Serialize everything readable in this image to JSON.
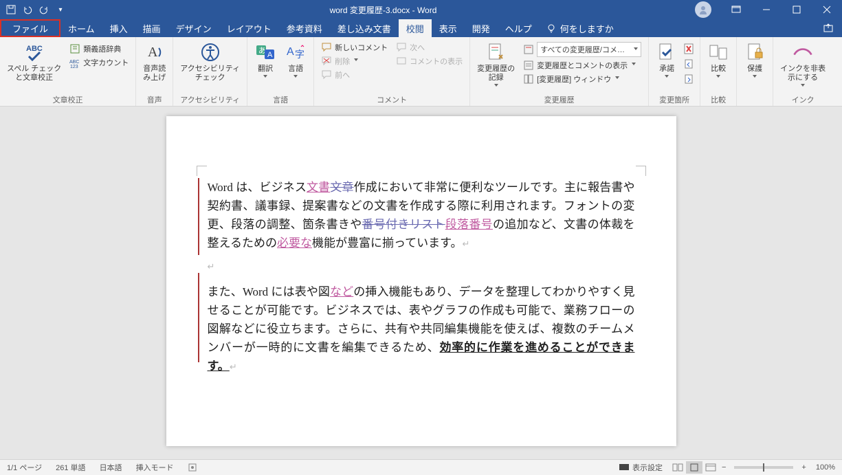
{
  "title": "word 変更履歴-3.docx  -  Word",
  "tabs": {
    "file": "ファイル",
    "home": "ホーム",
    "insert": "挿入",
    "draw": "描画",
    "design": "デザイン",
    "layout": "レイアウト",
    "references": "参考資料",
    "mailings": "差し込み文書",
    "review": "校閲",
    "view": "表示",
    "developer": "開発",
    "help": "ヘルプ",
    "search": "何をしますか"
  },
  "ribbon": {
    "proofing": {
      "spellcheck": "スペル チェック\nと文章校正",
      "thesaurus": "類義語辞典",
      "wordcount": "文字カウント",
      "group": "文章校正"
    },
    "speech": {
      "readaloud": "音声読\nみ上げ",
      "group": "音声"
    },
    "accessibility": {
      "check": "アクセシビリティ\nチェック",
      "group": "アクセシビリティ"
    },
    "language": {
      "translate": "翻訳",
      "language": "言語",
      "group": "言語"
    },
    "comments": {
      "new": "新しいコメント",
      "delete": "削除",
      "prev": "前へ",
      "next": "次へ",
      "show": "コメントの表示",
      "group": "コメント"
    },
    "tracking": {
      "track": "変更履歴の\n記録",
      "display_combo": "すべての変更履歴/コメ…",
      "showmarkup": "変更履歴とコメントの表示",
      "pane": "[変更履歴] ウィンドウ",
      "group": "変更履歴"
    },
    "changes": {
      "accept": "承諾",
      "group": "変更箇所"
    },
    "compare": {
      "compare": "比較",
      "group": "比較"
    },
    "protect": {
      "protect": "保護",
      "group": ""
    },
    "ink": {
      "hide": "インクを非表\n示にする",
      "group": "インク"
    }
  },
  "document": {
    "p1": {
      "t1": "Word は、ビジネス",
      "ins1": "文書",
      "del1": "文章",
      "t2": "作成において非常に便利なツールです。主に報告書や契約書、議事録、提案書などの文書を作成する際に利用されます。フォントの変更、段落の調整、箇条書きや",
      "del2": "番号付きリスト",
      "ins2": "段落番号",
      "t3": "の追加など、文書の体裁を整えるための",
      "ins3": "必要な",
      "t4": "機能が豊富に揃っています。"
    },
    "p2": {
      "t1": "また、Word には表や図",
      "ins1": "など",
      "t2": "の挿入機能もあり、データを整理してわかりやすく見せることが可能です。ビジネスでは、表やグラフの作成も可能で、業務フローの図解などに役立ちます。さらに、共有や共同編集機能を使えば、複数のチームメンバーが一時的に文書を編集できるため、",
      "u1": "効率的に作業を進めることができます。"
    }
  },
  "status": {
    "page": "1/1 ページ",
    "words": "261 単語",
    "lang": "日本語",
    "insert": "挿入モード",
    "display": "表示設定",
    "zoom": "100%"
  }
}
